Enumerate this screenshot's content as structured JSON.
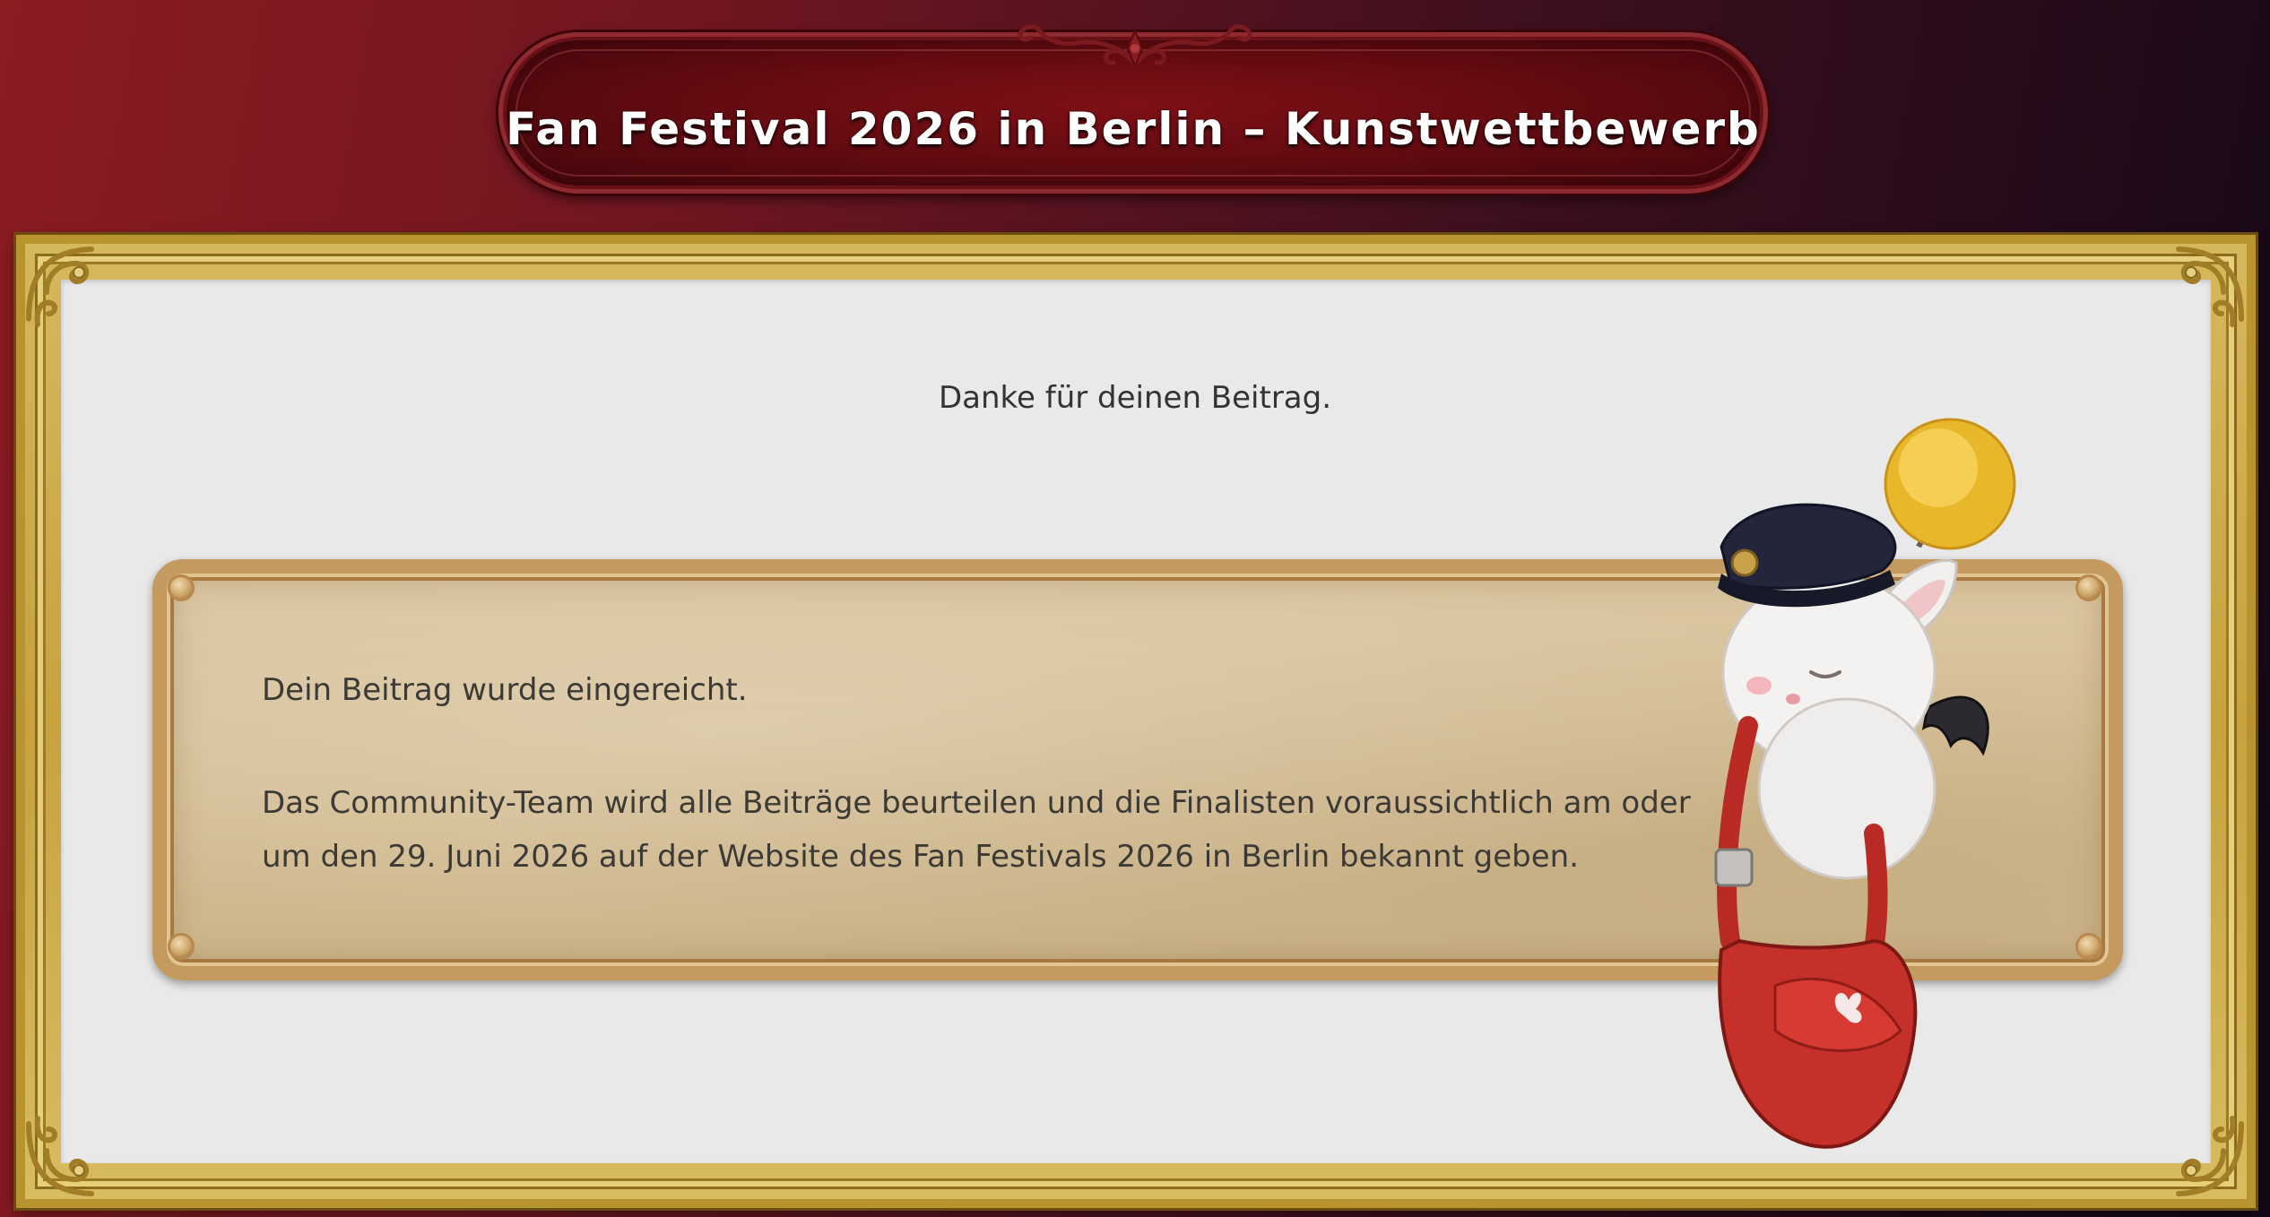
{
  "banner": {
    "title": "Fan Festival 2026 in Berlin – Kunstwettbewerb"
  },
  "main": {
    "thanks": "Danke für deinen Beitrag.",
    "card": {
      "submitted": "Dein Beitrag wurde eingereicht.",
      "message": "Das Community-Team wird alle Beiträge beurteilen und die Finalisten voraussichtlich am oder um den 29. Juni 2026 auf der Website des Fan Festivals 2026 in Berlin bekannt geben."
    }
  },
  "colors": {
    "background_left": "#8c1b22",
    "background_right": "#120818",
    "banner": "#5c0a10",
    "frame_gold": "#c7a23f",
    "panel": "#e9e9e9",
    "parchment": "#d5bf96",
    "text": "#3b3a36"
  },
  "icons": [
    "banner-ornament-icon",
    "frame-corner-ornament-icon",
    "moogle-mascot-icon"
  ]
}
